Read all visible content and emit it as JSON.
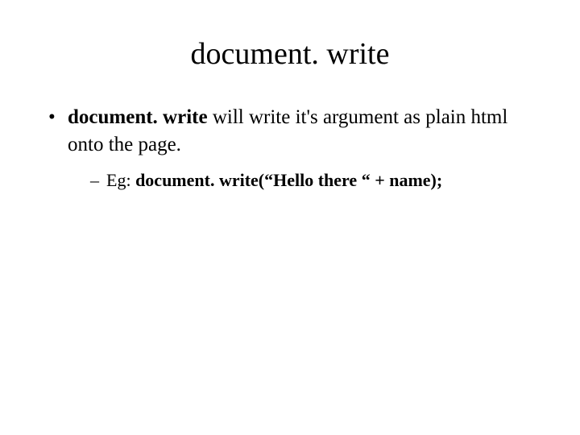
{
  "title": "document. write",
  "bullet": {
    "bold_prefix": "document. write",
    "rest": " will write it's argument as plain html onto the page."
  },
  "sub": {
    "prefix": "Eg: ",
    "bold": "document. write(“Hello there “ + name);"
  }
}
